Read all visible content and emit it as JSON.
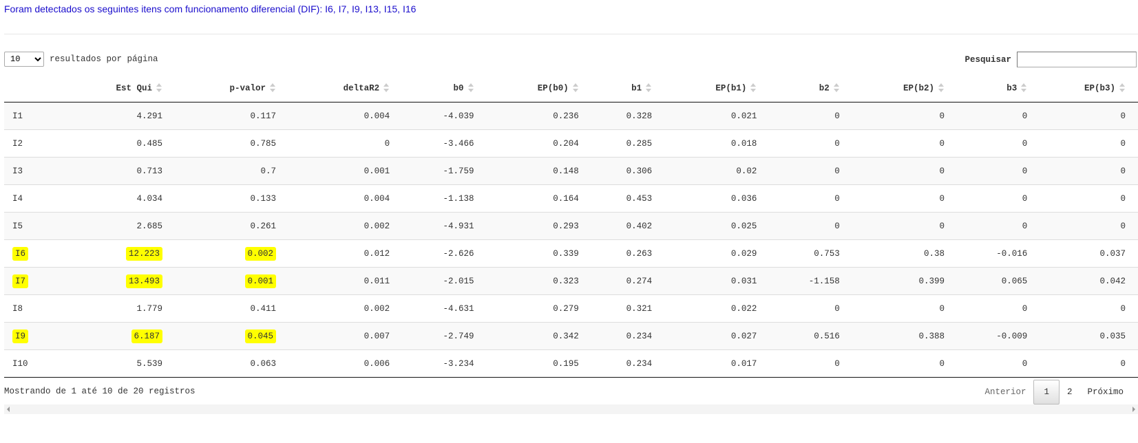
{
  "dif_message": "Foram detectados os seguintes itens com funcionamento diferencial (DIF): I6, I7, I9, I13, I15, I16",
  "length": {
    "value": "10",
    "suffix": "resultados por página"
  },
  "search": {
    "label": "Pesquisar",
    "value": ""
  },
  "table": {
    "headers": [
      "",
      "Est Qui",
      "p-valor",
      "deltaR2",
      "b0",
      "EP(b0)",
      "b1",
      "EP(b1)",
      "b2",
      "EP(b2)",
      "b3",
      "EP(b3)"
    ],
    "rows": [
      {
        "cells": [
          "I1",
          "4.291",
          "0.117",
          "0.004",
          "-4.039",
          "0.236",
          "0.328",
          "0.021",
          "0",
          "0",
          "0",
          "0"
        ],
        "highlight": false
      },
      {
        "cells": [
          "I2",
          "0.485",
          "0.785",
          "0",
          "-3.466",
          "0.204",
          "0.285",
          "0.018",
          "0",
          "0",
          "0",
          "0"
        ],
        "highlight": false
      },
      {
        "cells": [
          "I3",
          "0.713",
          "0.7",
          "0.001",
          "-1.759",
          "0.148",
          "0.306",
          "0.02",
          "0",
          "0",
          "0",
          "0"
        ],
        "highlight": false
      },
      {
        "cells": [
          "I4",
          "4.034",
          "0.133",
          "0.004",
          "-1.138",
          "0.164",
          "0.453",
          "0.036",
          "0",
          "0",
          "0",
          "0"
        ],
        "highlight": false
      },
      {
        "cells": [
          "I5",
          "2.685",
          "0.261",
          "0.002",
          "-4.931",
          "0.293",
          "0.402",
          "0.025",
          "0",
          "0",
          "0",
          "0"
        ],
        "highlight": false
      },
      {
        "cells": [
          "I6",
          "12.223",
          "0.002",
          "0.012",
          "-2.626",
          "0.339",
          "0.263",
          "0.029",
          "0.753",
          "0.38",
          "-0.016",
          "0.037"
        ],
        "highlight": true
      },
      {
        "cells": [
          "I7",
          "13.493",
          "0.001",
          "0.011",
          "-2.015",
          "0.323",
          "0.274",
          "0.031",
          "-1.158",
          "0.399",
          "0.065",
          "0.042"
        ],
        "highlight": true
      },
      {
        "cells": [
          "I8",
          "1.779",
          "0.411",
          "0.002",
          "-4.631",
          "0.279",
          "0.321",
          "0.022",
          "0",
          "0",
          "0",
          "0"
        ],
        "highlight": false
      },
      {
        "cells": [
          "I9",
          "6.187",
          "0.045",
          "0.007",
          "-2.749",
          "0.342",
          "0.234",
          "0.027",
          "0.516",
          "0.388",
          "-0.009",
          "0.035"
        ],
        "highlight": true
      },
      {
        "cells": [
          "I10",
          "5.539",
          "0.063",
          "0.006",
          "-3.234",
          "0.195",
          "0.234",
          "0.017",
          "0",
          "0",
          "0",
          "0"
        ],
        "highlight": false
      }
    ]
  },
  "info": "Mostrando de 1 até 10 de 20 registros",
  "pagination": {
    "previous": "Anterior",
    "pages": [
      "1",
      "2"
    ],
    "next": "Próximo"
  },
  "colors": {
    "highlight": "#ffff00",
    "link": "#1a0dcc"
  }
}
